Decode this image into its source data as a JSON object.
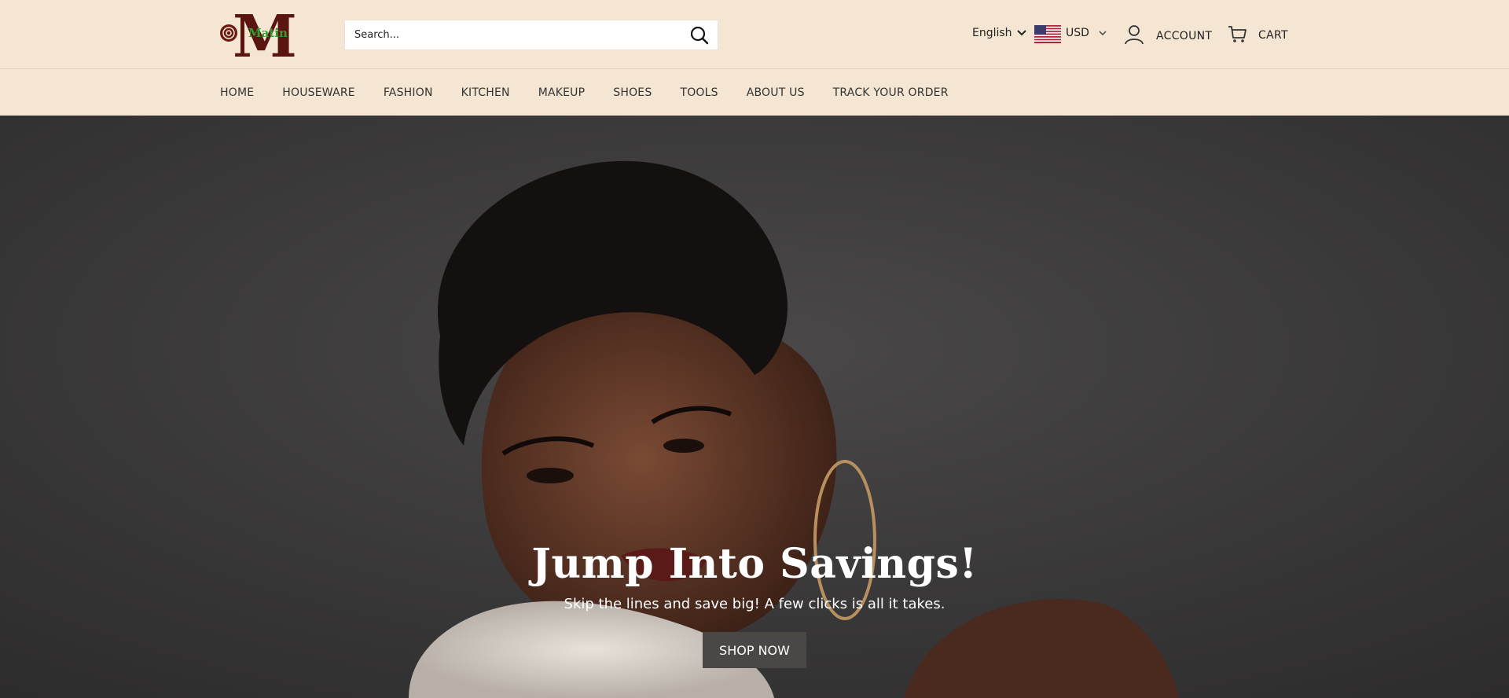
{
  "logo": {
    "text": "Matin",
    "letter": "M",
    "letter_color": "#5a1510",
    "text_color": "#2e9e2e"
  },
  "search": {
    "placeholder": "Search...",
    "icon": "search-icon"
  },
  "language": {
    "selected": "English",
    "icon": "chevron-down-icon"
  },
  "currency": {
    "selected": "USD",
    "flag": "us-flag-icon",
    "icon": "chevron-down-icon"
  },
  "account": {
    "label": "ACCOUNT",
    "icon": "user-icon"
  },
  "cart": {
    "label": "CART",
    "icon": "cart-icon"
  },
  "nav": {
    "items": [
      {
        "label": "HOME"
      },
      {
        "label": "HOUSEWARE"
      },
      {
        "label": "FASHION"
      },
      {
        "label": "KITCHEN"
      },
      {
        "label": "MAKEUP"
      },
      {
        "label": "SHOES"
      },
      {
        "label": "TOOLS"
      },
      {
        "label": "ABOUT US"
      },
      {
        "label": "TRACK YOUR ORDER"
      }
    ]
  },
  "hero": {
    "title": "Jump Into Savings!",
    "subtitle": "Skip the lines and save big! A few clicks is all it takes.",
    "cta": "SHOP NOW"
  },
  "colors": {
    "header_bg": "#f5e6d3",
    "hero_bg": "#3d3b3b",
    "button_bg": "#4a4745"
  }
}
